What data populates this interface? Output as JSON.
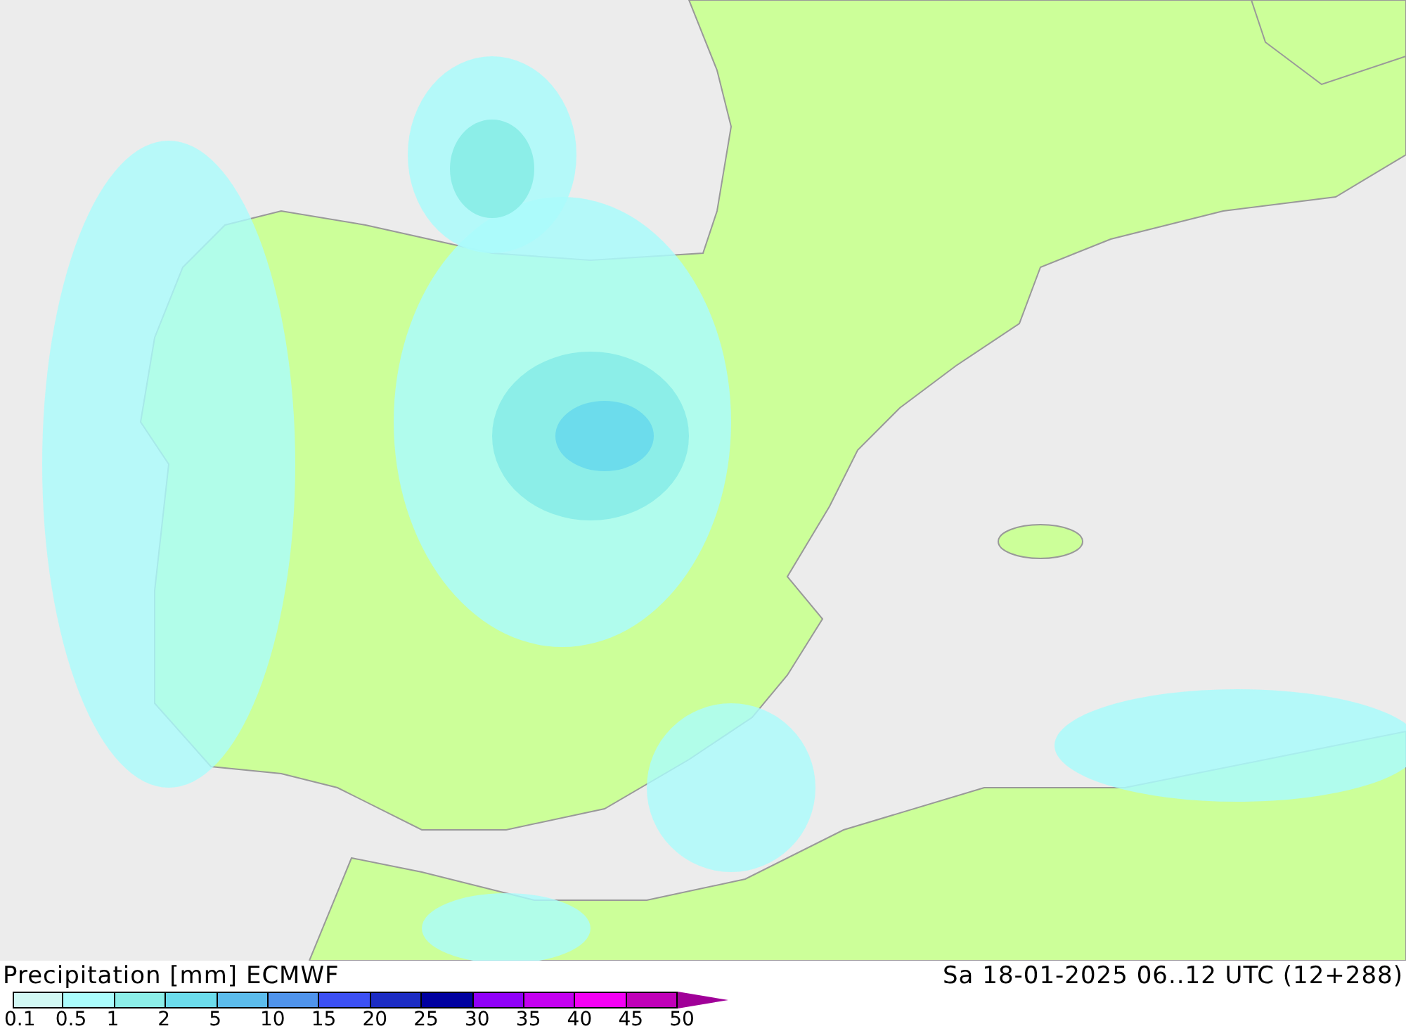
{
  "legend": {
    "title": "Precipitation [mm] ECMWF",
    "valid_time": "Sa 18-01-2025 06..12 UTC (12+288)",
    "segments": [
      {
        "color": "#d2f8f4"
      },
      {
        "color": "#aafcfc"
      },
      {
        "color": "#8ceee8"
      },
      {
        "color": "#6cdcec"
      },
      {
        "color": "#5cbcec"
      },
      {
        "color": "#5094ec"
      },
      {
        "color": "#3c50f4"
      },
      {
        "color": "#1c2cc4"
      },
      {
        "color": "#0000a0"
      },
      {
        "color": "#9000f8"
      },
      {
        "color": "#c400f0"
      },
      {
        "color": "#f400f4"
      },
      {
        "color": "#c000b8"
      },
      {
        "kind": "arrow",
        "color": "#a00098"
      }
    ],
    "ticks": [
      "0.1",
      "0.5",
      "1",
      "2",
      "5",
      "10",
      "15",
      "20",
      "25",
      "30",
      "35",
      "40",
      "45",
      "50"
    ]
  }
}
